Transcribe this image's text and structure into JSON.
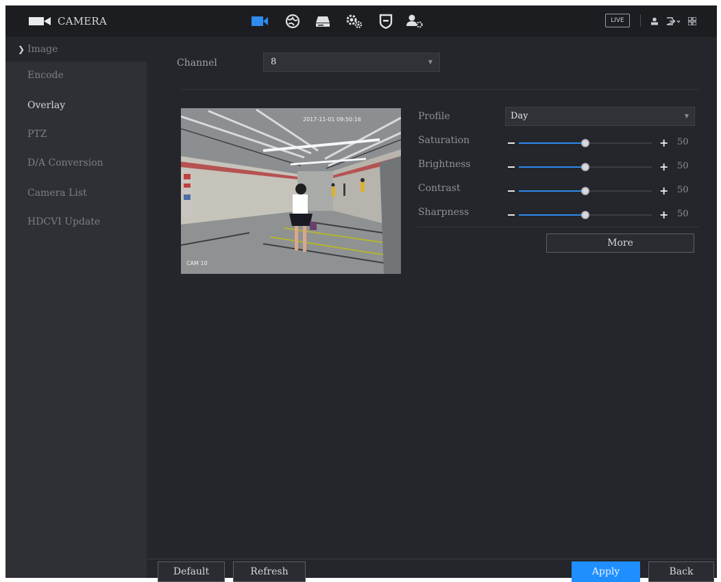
{
  "header": {
    "title": "CAMERA",
    "nav_icons": [
      "camera-icon",
      "network-globe-icon",
      "storage-hdd-icon",
      "system-settings-icon",
      "security-shield-icon",
      "account-user-icon"
    ],
    "live_label": "LIVE",
    "right_icons": [
      "user-icon",
      "logout-icon",
      "grid-menu-icon"
    ]
  },
  "sidebar": {
    "items": [
      {
        "label": "Image"
      },
      {
        "label": "Encode"
      },
      {
        "label": "Overlay"
      },
      {
        "label": "PTZ"
      },
      {
        "label": "D/A Conversion"
      },
      {
        "label": "Camera List"
      },
      {
        "label": "HDCVI Update"
      }
    ]
  },
  "main": {
    "channel": {
      "label": "Channel",
      "value": "8"
    },
    "preview": {
      "timestamp": "2017-11-01 09:50:16",
      "camera_name": "CAM 10"
    },
    "profile": {
      "label": "Profile",
      "value": "Day"
    },
    "sliders": [
      {
        "label": "Saturation",
        "value": 50
      },
      {
        "label": "Brightness",
        "value": 50
      },
      {
        "label": "Contrast",
        "value": 50
      },
      {
        "label": "Sharpness",
        "value": 50
      }
    ],
    "more_label": "More"
  },
  "footer": {
    "default_label": "Default",
    "refresh_label": "Refresh",
    "apply_label": "Apply",
    "back_label": "Back"
  },
  "colors": {
    "accent": "#1f8fff",
    "slider_fill": "#2e8bf0",
    "background": "#24262b",
    "sidebar": "#2e3035",
    "topbar": "#1c1d21"
  }
}
